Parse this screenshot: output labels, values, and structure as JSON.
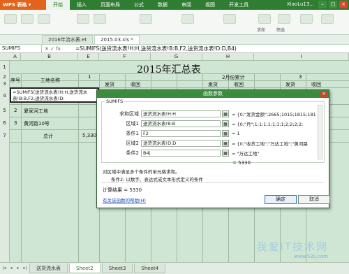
{
  "app": {
    "name": "WPS 表格",
    "user": "XiaoLu13..."
  },
  "menu": [
    "开始",
    "插入",
    "页面布局",
    "公式",
    "数据",
    "审阅",
    "视图",
    "开发工具"
  ],
  "doc_tabs": [
    "2016年流水表.et",
    "2015.03.xls *"
  ],
  "ribbon": {
    "sum_label": "求和",
    "filter_label": "筛选"
  },
  "formula_bar": {
    "name_box": "SUMIFS",
    "formula": "=SUMIFS(送货流水表!H:H,送货流水表!B:B,F2,送货流水表!D:D,B4)"
  },
  "sheet": {
    "columns": [
      "A",
      "B",
      "E",
      "F",
      "G",
      "H",
      "I"
    ],
    "title": "2015年汇总表",
    "headers": {
      "seq": "序号",
      "site": "工地名称",
      "col_e": "1",
      "col_g": "2月份累计",
      "col_i": "3"
    },
    "subheaders": [
      "发货",
      "收回",
      "发货",
      "收回",
      "发货",
      "收回"
    ],
    "row_numbers": [
      "1",
      "2",
      "3",
      "4",
      "5",
      "6",
      "7"
    ],
    "editing_formula": "=SUMIFS(送货流水表!H:H,送货流水表!B:B,F2,送货流水表!D:",
    "rows": [
      {
        "seq": "2",
        "site": "夏家河工地"
      },
      {
        "seq": "3",
        "site": "黄河路10号"
      },
      {
        "seq": "",
        "site": "总计",
        "value": "5,330"
      }
    ]
  },
  "dialog": {
    "title": "函数参数",
    "function": "SUMIFS",
    "args": [
      {
        "label": "求和区域",
        "value": "送货流水表!H:H",
        "result": "= {0;\"发货金额\";2665;1015;1815;181"
      },
      {
        "label": "区域1",
        "value": "送货流水表!B:B",
        "result": "= {0;\"月\";1;1;1;1;1;1;1;2;2;2;2;"
      },
      {
        "label": "条件1",
        "value": "F2",
        "result": "= 1"
      },
      {
        "label": "区域2",
        "value": "送货流水表!D:D",
        "result": "= {0;\"收货工地\";\"万达工地\";\"黄河路"
      },
      {
        "label": "条件2",
        "value": "B4|",
        "result": "= \"万达工地\""
      }
    ],
    "result_eq": "= 5330",
    "description": "对区域中满足多个条件的单元格求和。",
    "arg_description": "条件2:   以数字、表达式或文本形式定义的条件",
    "calc_result": "计算结果 = 5330",
    "help_link": "有关该函数的帮助(H)",
    "ok_label": "确定",
    "cancel_label": "取消"
  },
  "sheet_tabs": [
    "送货流水表",
    "Sheet2",
    "Sheet3",
    "Sheet4"
  ],
  "watermark": {
    "main": "我爱IT技术网",
    "url": "www.52ij.com"
  }
}
